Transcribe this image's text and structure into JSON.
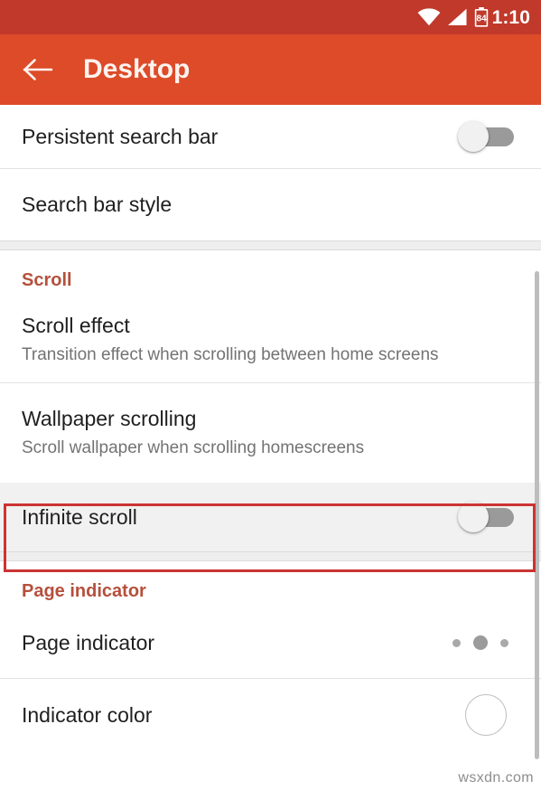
{
  "status_bar": {
    "time": "1:10",
    "battery_level": "84",
    "icons": [
      "wifi-icon",
      "cell-signal-icon",
      "battery-icon"
    ],
    "background_color": "#c0392b"
  },
  "app_bar": {
    "back_label": "←",
    "title": "Desktop",
    "background_color": "#dd4b28",
    "title_color": "#fdf2ee"
  },
  "settings": {
    "top_rows": [
      {
        "title": "Persistent search bar",
        "subtitle": "",
        "control": "toggle",
        "toggle_state": "off"
      },
      {
        "title": "Search bar style",
        "subtitle": "",
        "control": "none"
      }
    ],
    "sections": [
      {
        "header": "Scroll",
        "header_color": "#b5503c",
        "rows": [
          {
            "title": "Scroll effect",
            "subtitle": "Transition effect when scrolling between home screens",
            "control": "none",
            "highlighted": false
          },
          {
            "title": "Wallpaper scrolling",
            "subtitle": "Scroll wallpaper when scrolling homescreens",
            "control": "none",
            "highlighted": false
          },
          {
            "title": "Infinite scroll",
            "subtitle": "",
            "control": "toggle",
            "toggle_state": "off",
            "highlighted": true
          }
        ]
      },
      {
        "header": "Page indicator",
        "header_color": "#b5503c",
        "rows": [
          {
            "title": "Page indicator",
            "subtitle": "",
            "control": "dots",
            "highlighted": false
          },
          {
            "title": "Indicator color",
            "subtitle": "",
            "control": "color-swatch",
            "swatch_color": "#ffffff",
            "highlighted": false
          }
        ]
      }
    ]
  },
  "annotation": {
    "target": "Infinite scroll",
    "border_color": "#cc3333"
  },
  "watermark": {
    "text": "wsxdn.com"
  }
}
